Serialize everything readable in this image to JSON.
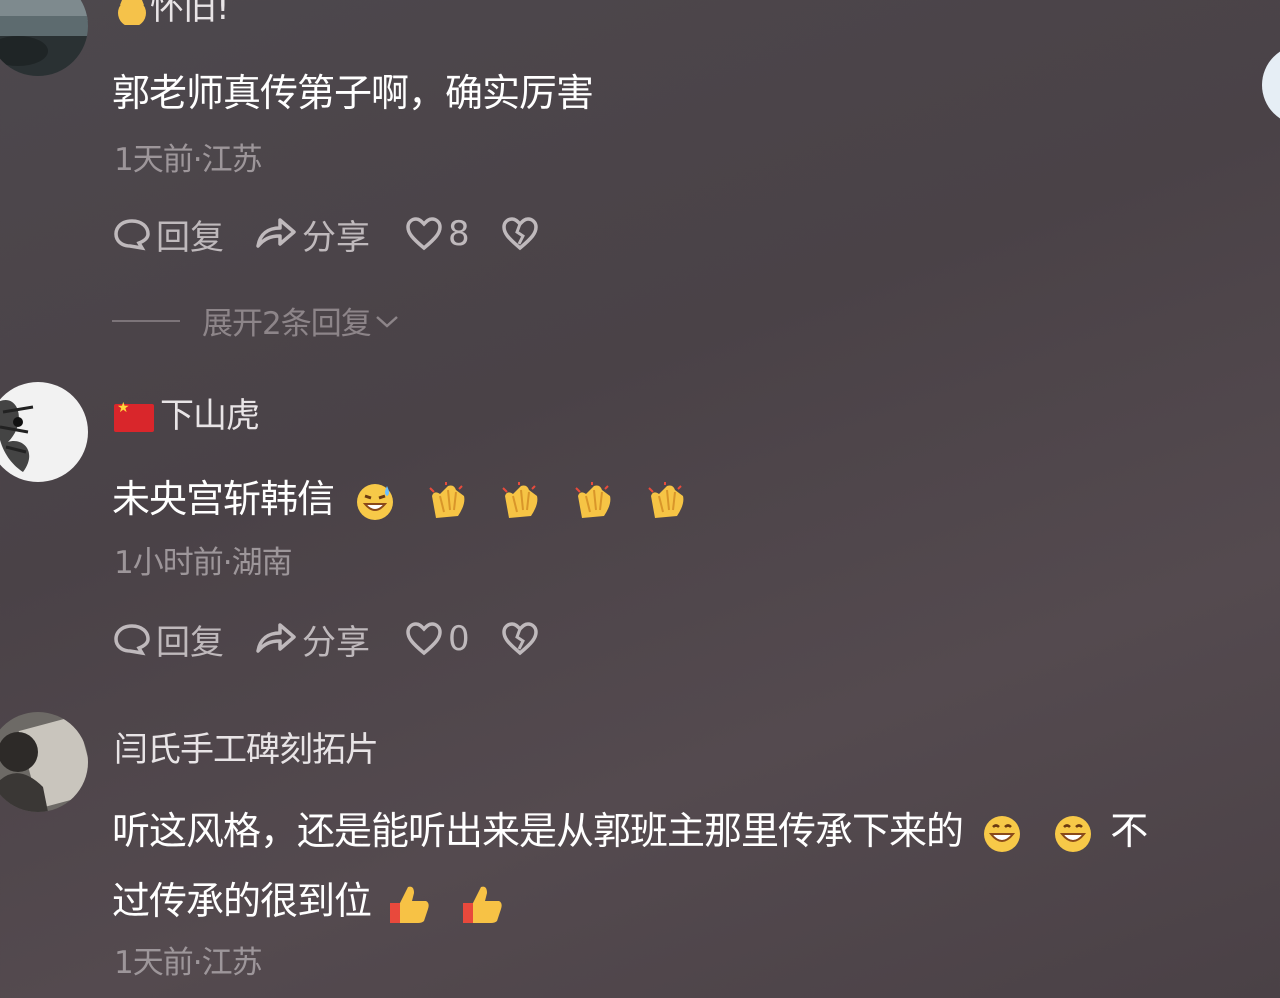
{
  "comments": [
    {
      "username": "怀旧!",
      "username_emoji": "cat-emoji",
      "text": "郭老师真传第子啊，确实厉害",
      "meta": "1天前·江苏",
      "reply_label": "回复",
      "share_label": "分享",
      "likes": "8",
      "expand_label": "展开2条回复"
    },
    {
      "username": "下山虎",
      "flag": "cn-flag",
      "text": "未央宫斩韩信",
      "emojis": [
        "grin-sweat-emoji",
        "clap-emoji",
        "clap-emoji",
        "clap-emoji",
        "clap-emoji"
      ],
      "meta": "1小时前·湖南",
      "reply_label": "回复",
      "share_label": "分享",
      "likes": "0"
    },
    {
      "username": "闫氏手工碑刻拓片",
      "text_line1": "听这风格，还是能听出来是从郭班主那里传承下来的",
      "text_line1_tail": "不",
      "text_line2": "过传承的很到位",
      "emojis": [
        "grin-emoji",
        "grin-emoji",
        "thumbs-up-emoji",
        "thumbs-up-emoji"
      ],
      "meta": "1天前·江苏"
    }
  ]
}
